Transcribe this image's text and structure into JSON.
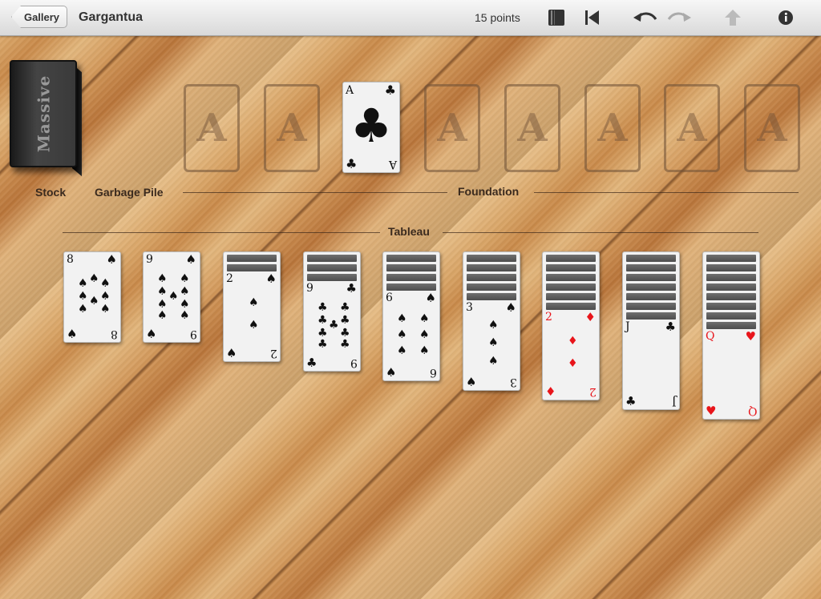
{
  "topbar": {
    "gallery_label": "Gallery",
    "title": "Gargantua",
    "points": "15 points",
    "icons": [
      "book-icon",
      "skip-to-start-icon",
      "undo-icon",
      "redo-icon",
      "up-arrow-icon",
      "info-icon"
    ]
  },
  "stock": {
    "label": "Stock",
    "deck_text": "Massive"
  },
  "garbage_pile": {
    "label": "Garbage Pile"
  },
  "foundation": {
    "label": "Foundation",
    "placeholder": "A",
    "top_card": {
      "rank": "A",
      "suit": "♣",
      "bottom_rank": "A"
    }
  },
  "tableau": {
    "label": "Tableau",
    "columns": [
      {
        "facedown": 0,
        "rank": "8",
        "suit": "♠",
        "color": "black"
      },
      {
        "facedown": 0,
        "rank": "9",
        "suit": "♠",
        "color": "black"
      },
      {
        "facedown": 2,
        "rank": "2",
        "suit": "♠",
        "color": "black"
      },
      {
        "facedown": 3,
        "rank": "9",
        "suit": "♣",
        "color": "black"
      },
      {
        "facedown": 4,
        "rank": "6",
        "suit": "♠",
        "color": "black"
      },
      {
        "facedown": 5,
        "rank": "3",
        "suit": "♠",
        "color": "black"
      },
      {
        "facedown": 6,
        "rank": "2",
        "suit": "♦",
        "color": "red"
      },
      {
        "facedown": 7,
        "rank": "J",
        "suit": "♣",
        "color": "black"
      },
      {
        "facedown": 8,
        "rank": "Q",
        "suit": "♥",
        "color": "red"
      }
    ]
  }
}
